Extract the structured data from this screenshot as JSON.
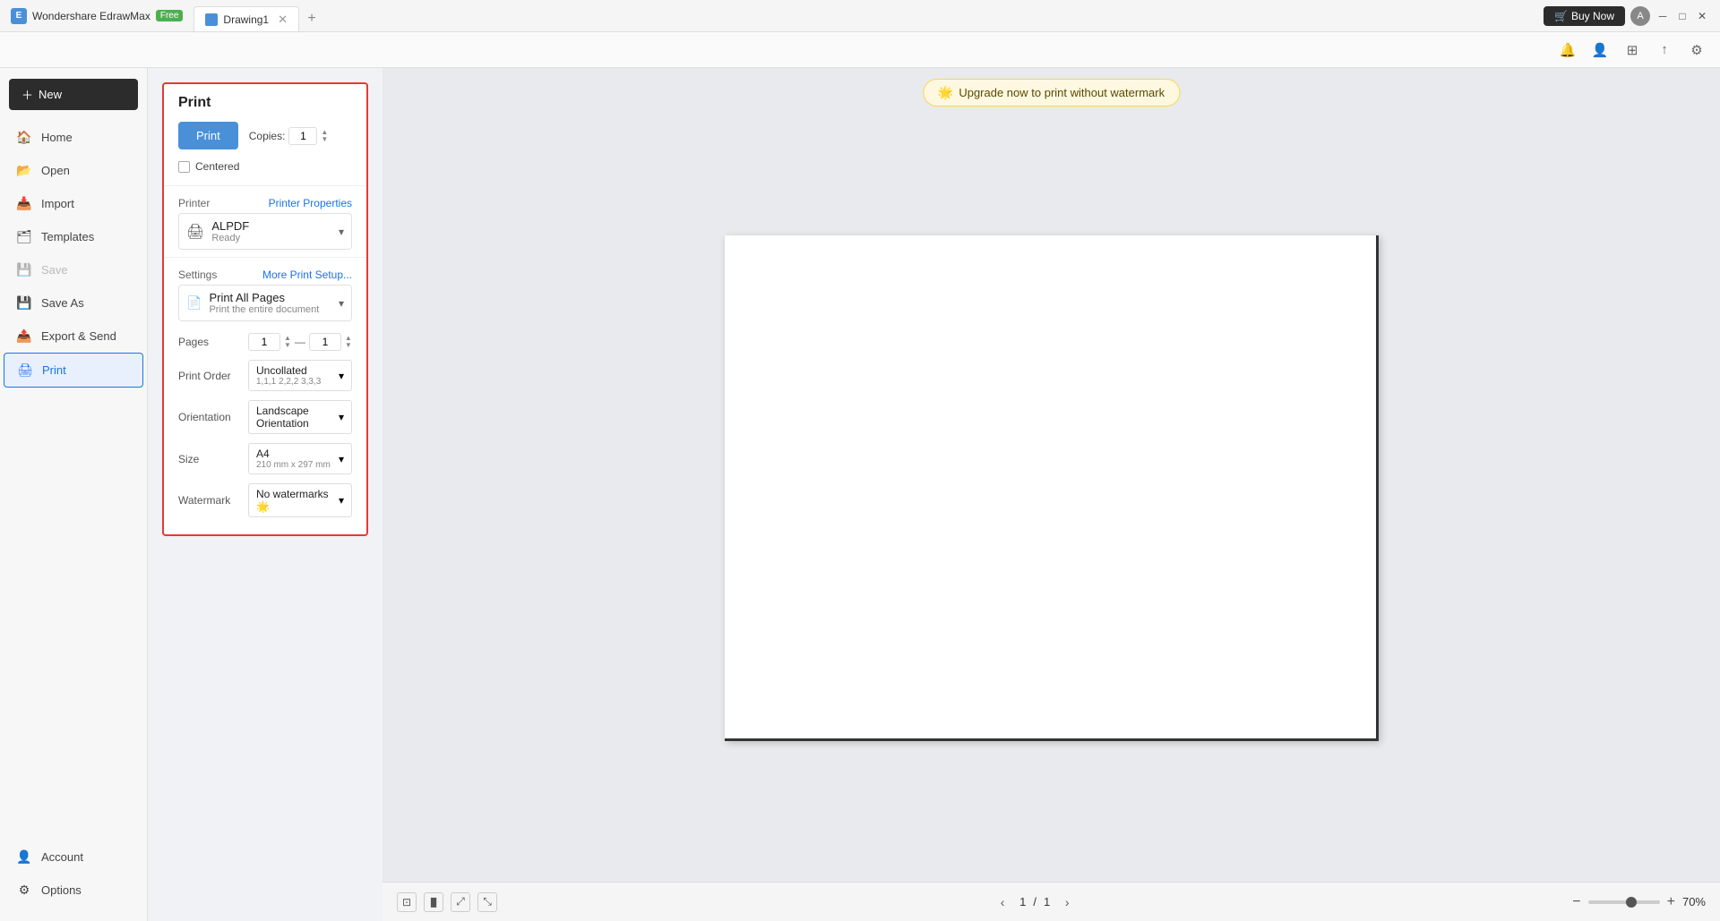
{
  "app": {
    "name": "Wondershare EdrawMax",
    "badge": "Free",
    "tab_name": "Drawing1",
    "buy_now": "Buy Now"
  },
  "iconbar": {
    "icons": [
      "bell",
      "user-circle",
      "grid",
      "upload",
      "settings"
    ]
  },
  "sidebar": {
    "new_label": "New",
    "items": [
      {
        "id": "home",
        "label": "Home",
        "icon": "🏠",
        "active": false,
        "disabled": false
      },
      {
        "id": "open",
        "label": "Open",
        "icon": "📂",
        "active": false,
        "disabled": false
      },
      {
        "id": "import",
        "label": "Import",
        "icon": "📥",
        "active": false,
        "disabled": false
      },
      {
        "id": "templates",
        "label": "Templates",
        "icon": "🗂",
        "active": false,
        "disabled": false
      },
      {
        "id": "save",
        "label": "Save",
        "icon": "💾",
        "active": false,
        "disabled": true
      },
      {
        "id": "save-as",
        "label": "Save As",
        "icon": "💾",
        "active": false,
        "disabled": false
      },
      {
        "id": "export-send",
        "label": "Export & Send",
        "icon": "📤",
        "active": false,
        "disabled": false
      },
      {
        "id": "print",
        "label": "Print",
        "icon": "🖨",
        "active": true,
        "disabled": false
      }
    ],
    "bottom_items": [
      {
        "id": "account",
        "label": "Account",
        "icon": "👤"
      },
      {
        "id": "options",
        "label": "Options",
        "icon": "⚙"
      }
    ]
  },
  "print": {
    "title": "Print",
    "print_btn": "Print",
    "copies_label": "Copies:",
    "copies_value": "1",
    "centered_label": "Centered",
    "printer_section": "Printer",
    "printer_properties": "Printer Properties",
    "printer_name": "ALPDF",
    "printer_status": "Ready",
    "settings_section": "Settings",
    "more_print_setup": "More Print Setup...",
    "print_all_pages": "Print All Pages",
    "print_all_pages_sub": "Print the entire document",
    "pages_label": "Pages",
    "pages_from": "1",
    "pages_to": "1",
    "print_order_label": "Print Order",
    "print_order_value": "Uncollated",
    "print_order_sub": "1,1,1  2,2,2  3,3,3",
    "orientation_label": "Orientation",
    "orientation_value": "Landscape Orientation",
    "size_label": "Size",
    "size_value": "A4",
    "size_sub": "210 mm x 297 mm",
    "watermark_label": "Watermark",
    "watermark_value": "No watermarks 🌟"
  },
  "upgrade": {
    "text": "Upgrade now to print without watermark",
    "icon": "🌟"
  },
  "footer": {
    "page_current": "1",
    "page_separator": "/",
    "page_total": "1",
    "zoom_percent": "70%"
  }
}
